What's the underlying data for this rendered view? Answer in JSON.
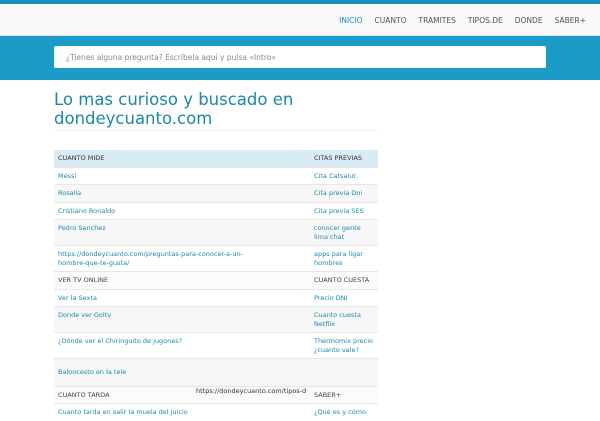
{
  "nav": {
    "items": [
      "INICIO",
      "CUANTO",
      "TRAMITES",
      "TIPOS.DE",
      "DONDE",
      "SABER+"
    ]
  },
  "search": {
    "placeholder": "¿Tienes alguna pregunta? Escríbela aquí y pulsa «Intro»"
  },
  "page": {
    "title": "Lo mas curioso y buscado en dondeycuanto.com"
  },
  "table": {
    "header": [
      "CUANTO MIDE",
      "CITAS PREVIAS"
    ],
    "rows": [
      [
        "Messi",
        "Cita Catsalut"
      ],
      [
        "Rosalia",
        "Cita previa Dni"
      ],
      [
        "Cristiano Ronaldo",
        "Cita previa SES"
      ],
      [
        "Pedro Sanchez",
        "conocer gente lima chat"
      ],
      [
        "https://dondeycuanto.com/preguntas-para-conocer-a-un-hombre-que-te-gusta/",
        "apps para ligar hombres"
      ]
    ],
    "section2": [
      "VER TV ONLINE",
      "CUANTO CUESTA"
    ],
    "rows2": [
      [
        "Ver la Sexta",
        "Precio DNI"
      ],
      [
        "Donde ver Goltv",
        "Cuanto cuesta Netflix"
      ],
      [
        "¿Dónde ver el Chiringuito de jugones?",
        "Thermomix precio ¿cuanto vale?"
      ],
      [
        "Baloncesto en la tele",
        ""
      ]
    ],
    "section3": [
      "CUANTO TARDA",
      "SABER+"
    ],
    "rows3": [
      [
        "Cuanto tarda en salir la muela del juicio",
        "¿Qué es y cómo"
      ]
    ],
    "spill_text": "https://dondeycuanto.com/tipos-de-herramientas-para-bricolaje"
  }
}
